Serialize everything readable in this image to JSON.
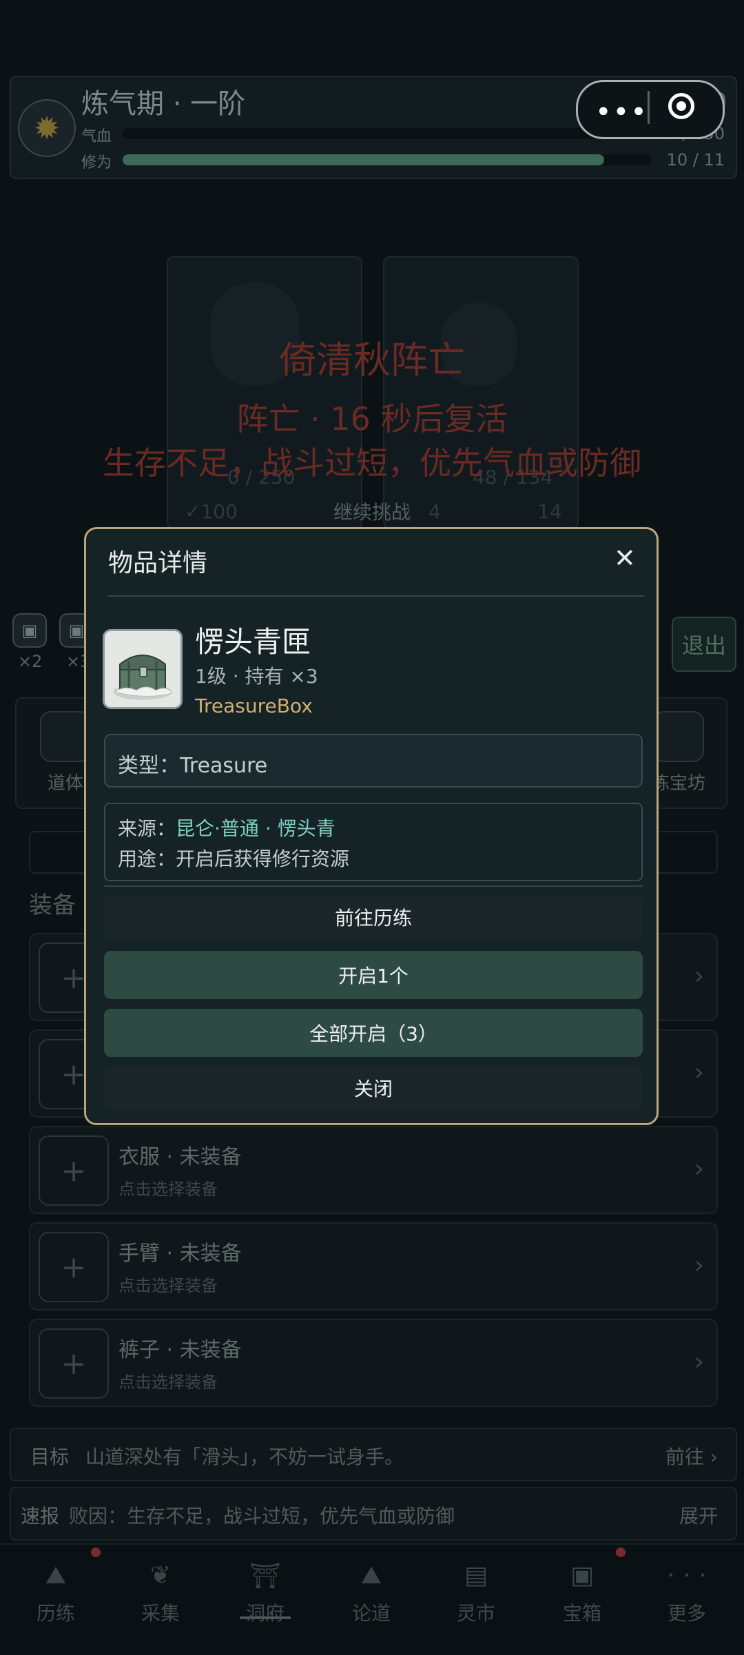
{
  "capsule": {
    "more": "•••"
  },
  "status": {
    "realm": "炼气期 · 一阶",
    "hp_label": "气血",
    "hp_value": "0 / 250",
    "hp_fraction": 0.0,
    "xp_label": "修为",
    "xp_value": "10 / 11",
    "xp_fraction": 0.91,
    "coin_partial": "00"
  },
  "battle": {
    "death_title": "倚清秋阵亡",
    "revive_text": "阵亡 · 16 秒后复活",
    "hint_text": "生存不足，战斗过短，优先气血或防御",
    "left_hp": "0 / 250",
    "right_hp": "48 / 134",
    "left_stat": "✓100",
    "mid_stat": "4",
    "right_stat": "14",
    "continue_label": "继续挑战"
  },
  "bag": {
    "count_1": "×2",
    "count_2": "×3",
    "exit_label": "退出"
  },
  "features": {
    "left_label": "道体",
    "right_label": "炼宝坊"
  },
  "equipment": {
    "section_title": "装备",
    "slots": [
      {
        "title": "",
        "subtitle": ""
      },
      {
        "title": "",
        "subtitle": ""
      },
      {
        "title": "衣服 · 未装备",
        "subtitle": "点击选择装备"
      },
      {
        "title": "手臂 · 未装备",
        "subtitle": "点击选择装备"
      },
      {
        "title": "裤子 · 未装备",
        "subtitle": "点击选择装备"
      }
    ],
    "plus": "+",
    "chevron": "›"
  },
  "goal": {
    "label": "目标",
    "text": "山道深处有「滑头」，不妨一试身手。",
    "action": "前往 ›"
  },
  "report": {
    "label": "速报",
    "text": "败因：生存不足，战斗过短，优先气血或防御",
    "action": "展开"
  },
  "nav": {
    "items": [
      {
        "label": "历练",
        "icon": "mountain-icon"
      },
      {
        "label": "采集",
        "icon": "herb-icon"
      },
      {
        "label": "洞府",
        "icon": "pavilion-icon"
      },
      {
        "label": "论道",
        "icon": "mountain-icon"
      },
      {
        "label": "灵市",
        "icon": "market-icon"
      },
      {
        "label": "宝箱",
        "icon": "chest-icon"
      },
      {
        "label": "更多",
        "icon": "more-icon"
      }
    ],
    "more_glyph": "· · ·"
  },
  "modal": {
    "title": "物品详情",
    "close": "✕",
    "item_name": "愣头青匣",
    "item_meta": "1级 · 持有 ×3",
    "item_class": "TreasureBox",
    "type_label": "类型：",
    "type_value": "Treasure",
    "source_label": "来源：",
    "source_value": "昆仑·普通 · 愣头青",
    "usage_label": "用途：",
    "usage_value": "开启后获得修行资源",
    "btn_go": "前往历练",
    "btn_open_one": "开启1个",
    "btn_open_all": "全部开启（3）",
    "btn_close": "关闭"
  },
  "colors": {
    "accent_gold": "#d1b06a",
    "accent_teal": "#7fd0c0",
    "button_green": "#2d4a43",
    "danger_red": "#6b2a23"
  }
}
